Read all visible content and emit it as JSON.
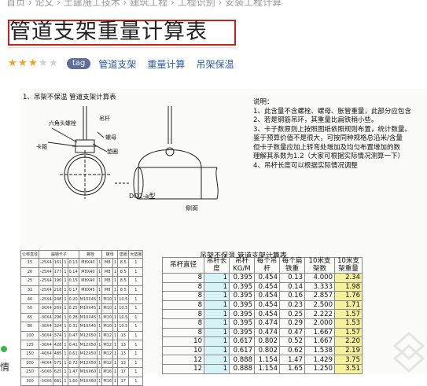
{
  "breadcrumb": "首页 › 论文 › 土建施工技术 › 建筑工程 › 工程识别 › 安装工程计算",
  "title": "管道支架重量计算表",
  "rating": {
    "value": 3,
    "max": 5
  },
  "tag_badge": "tag",
  "tags": [
    "管道支架",
    "重量计算",
    "吊架保温"
  ],
  "doc": {
    "heading": "1、吊架不保温 管道支架计算表",
    "notes_title": "说明：",
    "notes": [
      "1、此含量不含螺栓、螺母、胀管重量，此部分应包含",
      "2、若是钢筋吊环，其重量比扁铁稍小些。",
      "3、卡子数原则上按照图纸依照规则布置，统计数量。",
      "   鉴于预算价值不是很大，可按同种规格总沿米/含量",
      "   但卡子数量应加上转弯处增加及均匀布置增加的数",
      "   理解其系数为1.2（大家可根据实际情况测算一下）",
      "4、吊杆长度可以根据实际情况调整"
    ],
    "drawing_label": "DQ2-a型",
    "drawing_parts": [
      "六角头螺栓",
      "吊杆",
      "螺母",
      "垫圈",
      "卡箍",
      "侧面"
    ],
    "left_table": {
      "headers": [
        "公称直径",
        "扁钢卡子",
        "螺栓",
        "螺母",
        "垫圈",
        "大垫圈"
      ],
      "rows": [
        [
          "15",
          "-25X4",
          "161",
          "1",
          "0.13",
          "M8X40",
          "1",
          "M8",
          "1",
          "8.5",
          "1"
        ],
        [
          "20",
          "-25X4",
          "177",
          "1",
          "0.14",
          "M8X40",
          "1",
          "M8",
          "1",
          "8.5",
          "1"
        ],
        [
          "25",
          "-25X4",
          "190",
          "1",
          "0.15",
          "M8X40",
          "1",
          "M8",
          "1",
          "8.5",
          "1"
        ],
        [
          "32",
          "-25X4",
          "218",
          "1",
          "0.17",
          "M8X45",
          "1",
          "M8",
          "1",
          "8.5",
          "1"
        ],
        [
          "40",
          "-25X4",
          "248",
          "1",
          "0.20",
          "M10X45",
          "1",
          "M10",
          "1",
          "10.5",
          "1"
        ],
        [
          "50",
          "-30X4",
          "269",
          "1",
          "0.25",
          "M10X45",
          "1",
          "M10",
          "1",
          "10.5",
          "1"
        ],
        [
          "65",
          "-30X4",
          "296",
          "1",
          "0.28",
          "M10X45",
          "1",
          "M10",
          "1",
          "10.5",
          "1"
        ],
        [
          "80",
          "-30X4",
          "324",
          "1",
          "0.31",
          "M10X45",
          "1",
          "M10",
          "1",
          "10.5",
          "1"
        ],
        [
          "100",
          "-30X4",
          "374",
          "1",
          "0.47",
          "M12X50",
          "1",
          "M12",
          "1",
          "13",
          "1"
        ],
        [
          "125",
          "-30X4",
          "428",
          "1",
          "0.41",
          "M12X50",
          "1",
          "M12",
          "1",
          "13",
          "1"
        ],
        [
          "150",
          "-40X4",
          "485",
          "1",
          "0.61",
          "M12X50",
          "1",
          "M12",
          "1",
          "13",
          "1"
        ],
        [
          "200",
          "-40X4",
          "575",
          "1",
          "0.72",
          "M12X50",
          "1",
          "M12",
          "1",
          "13",
          "1"
        ],
        [
          "250",
          "-50X6",
          "625",
          "1",
          "1.47",
          "M16X60",
          "1",
          "M16",
          "1",
          "17",
          "1"
        ],
        [
          "300",
          "-50X6",
          "681",
          "1",
          "1.60",
          "M16X60",
          "1",
          "M16",
          "1",
          "17",
          "1"
        ]
      ]
    },
    "calc_table": {
      "title": "吊架不保温 管道支架计算表",
      "headers": [
        "吊杆直径",
        "吊杆长度",
        "吊杆KG/M",
        "每个吊杆",
        "每个扁铁重",
        "10米支架数",
        "10米支架重量"
      ],
      "rows": [
        [
          "8",
          "1",
          "0.395",
          "0.454",
          "0.13",
          "4.000",
          "2.34"
        ],
        [
          "8",
          "1",
          "0.395",
          "0.454",
          "0.14",
          "3.333",
          "1.98"
        ],
        [
          "8",
          "1",
          "0.395",
          "0.454",
          "0.16",
          "2.857",
          "1.76"
        ],
        [
          "8",
          "1",
          "0.395",
          "0.454",
          "0.23",
          "2.500",
          "1.71"
        ],
        [
          "8",
          "1",
          "0.395",
          "0.454",
          "0.25",
          "2.222",
          "1.57"
        ],
        [
          "8",
          "1",
          "0.395",
          "0.474",
          "0.29",
          "2.000",
          "1.53"
        ],
        [
          "8",
          "1",
          "0.395",
          "0.474",
          "0.47",
          "1.667",
          "1.57"
        ],
        [
          "10",
          "1",
          "0.617",
          "0.802",
          "0.52",
          "1.667",
          "2.20"
        ],
        [
          "10",
          "1",
          "0.617",
          "0.802",
          "0.62",
          "1.538",
          "2.19"
        ],
        [
          "12",
          "1",
          "0.888",
          "1.154",
          "1.47",
          "1.429",
          "3.75"
        ],
        [
          "12",
          "1",
          "0.888",
          "1.154",
          "1.65",
          "1.250",
          "3.51"
        ]
      ]
    }
  },
  "side_text": "情"
}
